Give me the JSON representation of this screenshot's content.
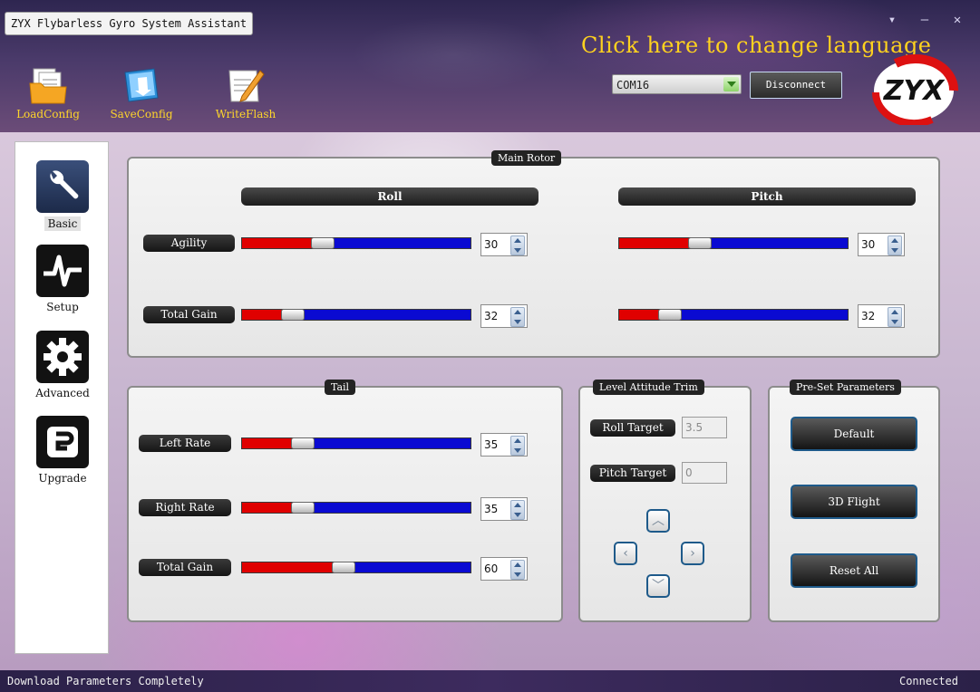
{
  "window": {
    "title": "ZYX Flybarless Gyro System Assistant",
    "controls": [
      "▾",
      "–",
      "✕"
    ]
  },
  "header": {
    "language_link": "Click here to change language",
    "toolbar": [
      {
        "label": "LoadConfig",
        "icon": "folder-document-icon"
      },
      {
        "label": "SaveConfig",
        "icon": "save-icon"
      },
      {
        "label": "WriteFlash",
        "icon": "write-flash-icon"
      }
    ],
    "port": "COM16",
    "disconnect_label": "Disconnect",
    "logo_text": "ZYX"
  },
  "sidebar": {
    "items": [
      {
        "label": "Basic",
        "icon": "wrench-icon",
        "active": true
      },
      {
        "label": "Setup",
        "icon": "pulse-icon",
        "active": false
      },
      {
        "label": "Advanced",
        "icon": "gear-icon",
        "active": false
      },
      {
        "label": "Upgrade",
        "icon": "upgrade-icon",
        "active": false
      }
    ]
  },
  "main_rotor": {
    "title": "Main Rotor",
    "roll": {
      "header": "Roll",
      "agility_label": "Agility",
      "agility_value": "30",
      "agility_fraction": 0.35,
      "total_gain_label": "Total Gain",
      "total_gain_value": "32",
      "total_gain_fraction": 0.22
    },
    "pitch": {
      "header": "Pitch",
      "agility_value": "30",
      "agility_fraction": 0.35,
      "total_gain_value": "32",
      "total_gain_fraction": 0.22
    }
  },
  "tail": {
    "title": "Tail",
    "left_rate_label": "Left Rate",
    "left_rate_value": "35",
    "left_rate_fraction": 0.26,
    "right_rate_label": "Right Rate",
    "right_rate_value": "35",
    "right_rate_fraction": 0.26,
    "total_gain_label": "Total Gain",
    "total_gain_value": "60",
    "total_gain_fraction": 0.44
  },
  "level_trim": {
    "title": "Level Attitude Trim",
    "roll_target_label": "Roll Target",
    "roll_target_value": "3.5",
    "pitch_target_label": "Pitch Target",
    "pitch_target_value": "0"
  },
  "presets": {
    "title": "Pre-Set Parameters",
    "buttons": [
      "Default",
      "3D Flight",
      "Reset All"
    ]
  },
  "status": {
    "left": "Download Parameters Completely",
    "right": "Connected"
  },
  "colors": {
    "language_link": "#ffd21e",
    "slider_fill": "#e00000",
    "slider_track": "#0a0ad2",
    "button_border": "#1e5a8a"
  }
}
